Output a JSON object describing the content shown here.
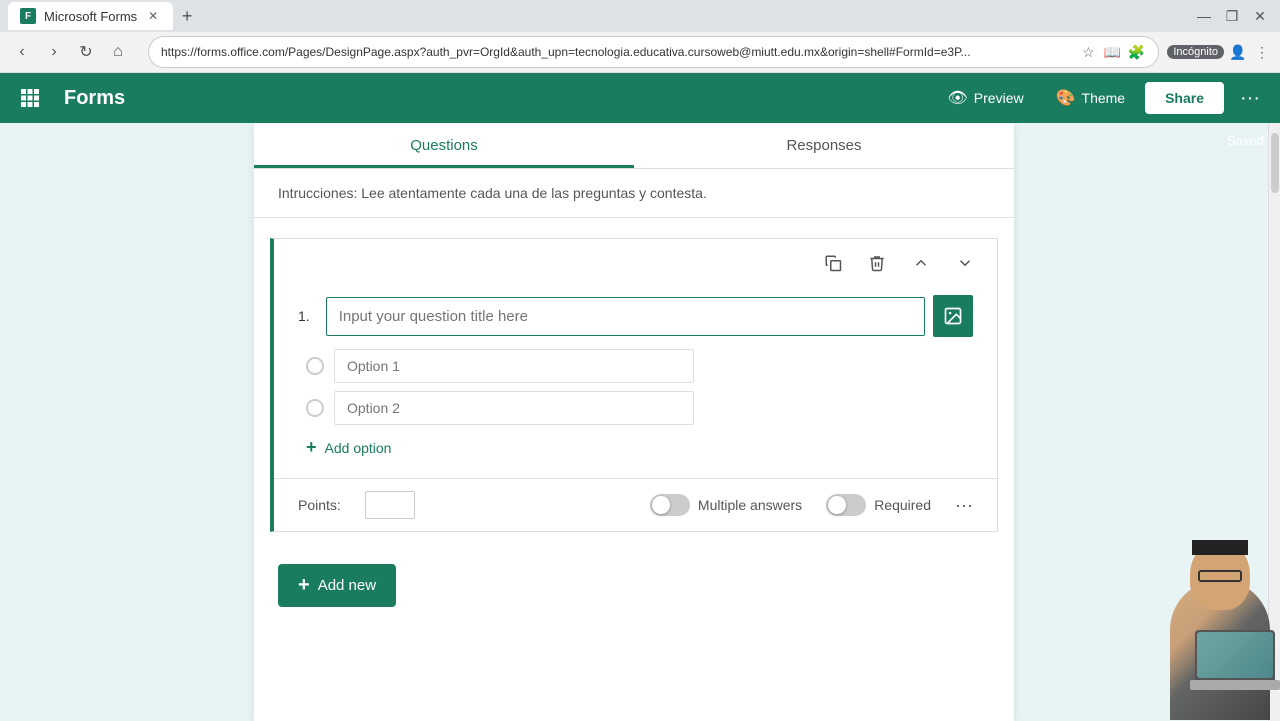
{
  "browser": {
    "tab_title": "Microsoft Forms",
    "tab_favicon": "F",
    "address": "https://forms.office.com/Pages/DesignPage.aspx?auth_pvr=OrgId&auth_upn=tecnologia.educativa.cursoweb@miutt.edu.mx&origin=shell#FormId=e3P...",
    "incognito_label": "Incógnito",
    "new_tab_label": "+",
    "window_minimize": "—",
    "window_maximize": "❐",
    "window_close": "✕"
  },
  "header": {
    "app_name": "Forms",
    "preview_label": "Preview",
    "theme_label": "Theme",
    "share_label": "Share",
    "more_label": "···",
    "saved_label": "Saved"
  },
  "tabs": {
    "questions_label": "Questions",
    "responses_label": "Responses"
  },
  "form": {
    "instructions": "Intrucciones: Lee atentamente cada una de las preguntas y contesta.",
    "question_number": "1.",
    "question_placeholder": "Input your question title here",
    "option1_value": "Option 1",
    "option2_value": "Option 2",
    "add_option_label": "Add option",
    "points_label": "Points:",
    "multiple_answers_label": "Multiple answers",
    "required_label": "Required"
  },
  "toolbar": {
    "duplicate_title": "Duplicate",
    "delete_title": "Delete",
    "move_up_title": "Move up",
    "move_down_title": "Move down"
  },
  "add_new": {
    "label": "Add new"
  }
}
